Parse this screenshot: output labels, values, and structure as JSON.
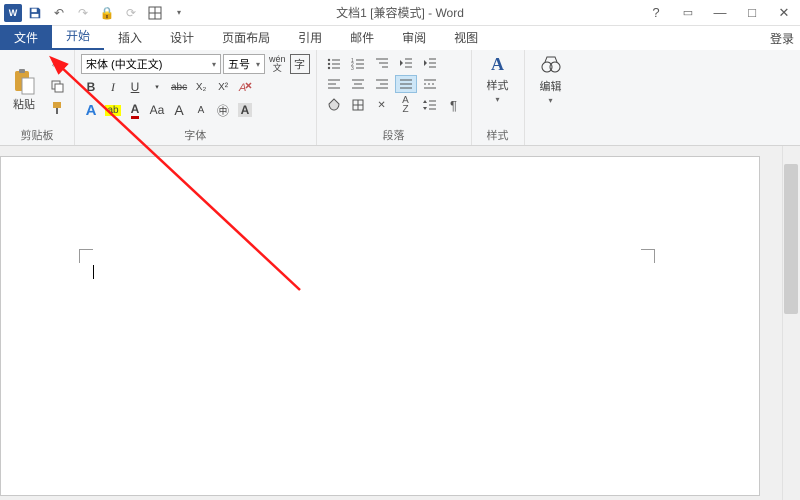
{
  "app": {
    "badge": "W",
    "title": "文档1 [兼容模式] - Word",
    "login": "登录"
  },
  "tabs": {
    "file": "文件",
    "home": "开始",
    "insert": "插入",
    "design": "设计",
    "layout": "页面布局",
    "ref": "引用",
    "mail": "邮件",
    "review": "审阅",
    "view": "视图"
  },
  "clipboard": {
    "paste": "粘贴",
    "group": "剪贴板"
  },
  "font": {
    "name": "宋体 (中文正文)",
    "size": "五号",
    "group": "字体",
    "bold": "B",
    "italic": "I",
    "underline": "U",
    "strike": "abc",
    "sub": "X₂",
    "sup": "X²",
    "phonetic": "wén",
    "charbox": "字",
    "effects": "A",
    "highlight": "ab",
    "color": "A",
    "case": "Aa",
    "grow": "A",
    "shrink": "A",
    "clear": "A",
    "circled": "㊥"
  },
  "paragraph": {
    "group": "段落"
  },
  "styles": {
    "label": "样式",
    "group": "样式"
  },
  "editing": {
    "label": "编辑"
  }
}
